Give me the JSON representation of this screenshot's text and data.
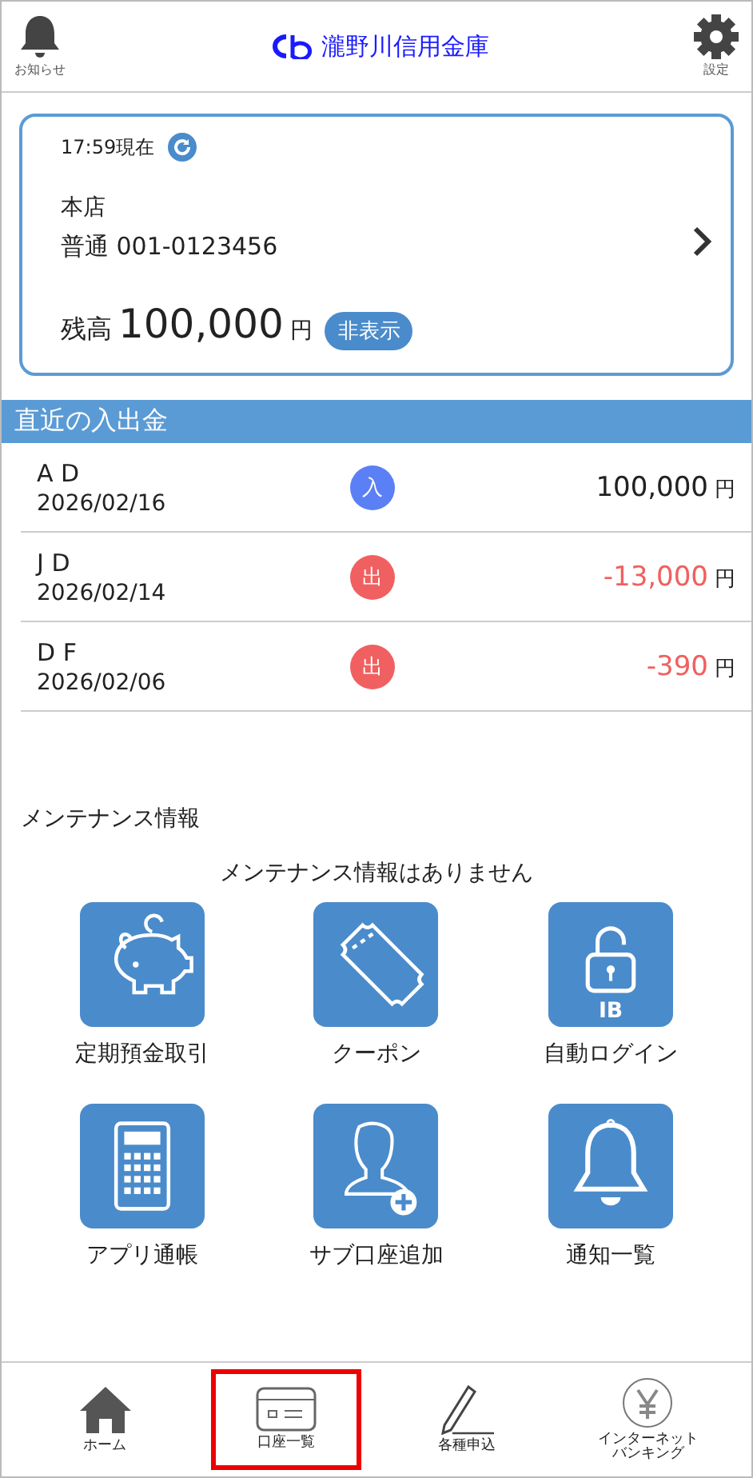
{
  "header": {
    "left": {
      "label": "お知らせ"
    },
    "title": "瀧野川信用金庫",
    "right": {
      "label": "設定"
    }
  },
  "account_card": {
    "timestamp": "17:59現在",
    "branch": "本店",
    "account": "普通 001-0123456",
    "balance_label": "残高",
    "balance": "100,000",
    "currency": "円",
    "toggle": "非表示"
  },
  "recent": {
    "title": "直近の入出金",
    "rows": [
      {
        "name": "A D",
        "date": "2026/02/16",
        "kind": "in",
        "badge": "入",
        "amount": "100,000",
        "currency": "円"
      },
      {
        "name": "J D",
        "date": "2026/02/14",
        "kind": "out",
        "badge": "出",
        "amount": "-13,000",
        "currency": "円"
      },
      {
        "name": "D F",
        "date": "2026/02/06",
        "kind": "out",
        "badge": "出",
        "amount": "-390",
        "currency": "円"
      }
    ]
  },
  "maintenance": {
    "title": "メンテナンス情報",
    "message": "メンテナンス情報はありません"
  },
  "tiles": [
    {
      "kind": "piggy",
      "label": "定期預金取引"
    },
    {
      "kind": "coupon",
      "label": "クーポン"
    },
    {
      "kind": "lock",
      "label": "自動ログイン",
      "icon_text": "IB"
    },
    {
      "kind": "calculator",
      "label": "アプリ通帳"
    },
    {
      "kind": "person",
      "label": "サブ口座追加"
    },
    {
      "kind": "bell",
      "label": "通知一覧"
    }
  ],
  "tab_bar": [
    {
      "kind": "home",
      "label": [
        "ホーム"
      ],
      "highlighted": false
    },
    {
      "kind": "card",
      "label": [
        "口座一覧"
      ],
      "highlighted": true
    },
    {
      "kind": "pencil",
      "label": [
        "各種申込"
      ],
      "highlighted": false
    },
    {
      "kind": "yen",
      "label": [
        "インターネット",
        "バンキング"
      ],
      "highlighted": false
    }
  ]
}
